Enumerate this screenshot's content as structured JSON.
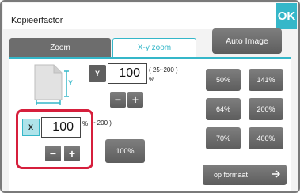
{
  "dialog": {
    "title": "Kopieerfactor",
    "ok_label": "OK"
  },
  "tabs": [
    {
      "label": "Zoom"
    },
    {
      "label": "X-y zoom"
    }
  ],
  "auto_image_label": "Auto Image",
  "y": {
    "label": "Y",
    "value": "100",
    "range": "( 25~200 )",
    "unit": "%"
  },
  "x": {
    "label": "X",
    "value": "100",
    "range": "~200 )",
    "unit": "%"
  },
  "stepper": {
    "minus": "−",
    "plus": "+"
  },
  "reset_label": "100%",
  "presets": [
    "50%",
    "141%",
    "64%",
    "200%",
    "70%",
    "400%"
  ],
  "fit_label": "op formaat",
  "colors": {
    "accent": "#35b7c9",
    "highlight": "#d61f3c"
  },
  "icons": {
    "fit_arrow": "arrow-right-icon",
    "page": "page-xy-icon"
  }
}
